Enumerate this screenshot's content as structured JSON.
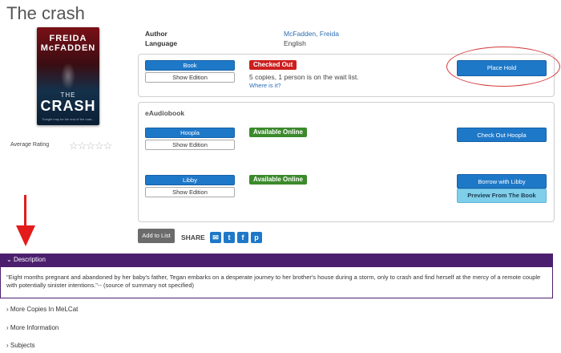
{
  "page": {
    "title": "The crash"
  },
  "cover": {
    "author_line1": "FREIDA",
    "author_line2": "McFADDEN",
    "title_small": "THE",
    "title_big": "CRASH",
    "tagline": "Tonight may be the end of the road..."
  },
  "rating": {
    "label": "Average Rating",
    "stars": "☆☆☆☆☆",
    "value_out_of_5": 0
  },
  "meta": {
    "author_label": "Author",
    "author_value": "McFadden, Freida",
    "language_label": "Language",
    "language_value": "English"
  },
  "book_panel": {
    "format_button": "Book",
    "show_edition": "Show Edition",
    "status_badge": "Checked Out",
    "availability": "5 copies, 1 person is on the wait list.",
    "where_link": "Where is it?",
    "action_button": "Place Hold"
  },
  "eaudiobook_panel": {
    "heading": "eAudiobook",
    "items": [
      {
        "format_button": "Hoopla",
        "show_edition": "Show Edition",
        "status_badge": "Available Online",
        "action_button": "Check Out Hoopla"
      },
      {
        "format_button": "Libby",
        "show_edition": "Show Edition",
        "status_badge": "Available Online",
        "action_button": "Borrow with Libby",
        "secondary_button": "Preview From The Book"
      }
    ]
  },
  "actions": {
    "add_to_list": "Add to List",
    "share_label": "SHARE"
  },
  "description": {
    "header": "Description",
    "text": "\"Eight months pregnant and abandoned by her baby's father, Tegan embarks on a desperate journey to her brother's house during a storm, only to crash and find herself at the mercy of a remote couple with potentially sinister intentions.\"-- (source of summary not specified)"
  },
  "sections": [
    "More Copies In MeLCat",
    "More Information",
    "Subjects"
  ],
  "colors": {
    "primary_blue": "#1e78c8",
    "description_bar": "#4c1f6e",
    "checked_out_red": "#cc1f1f",
    "available_green": "#3b8a2b",
    "annotation_red": "#e31b1b"
  }
}
